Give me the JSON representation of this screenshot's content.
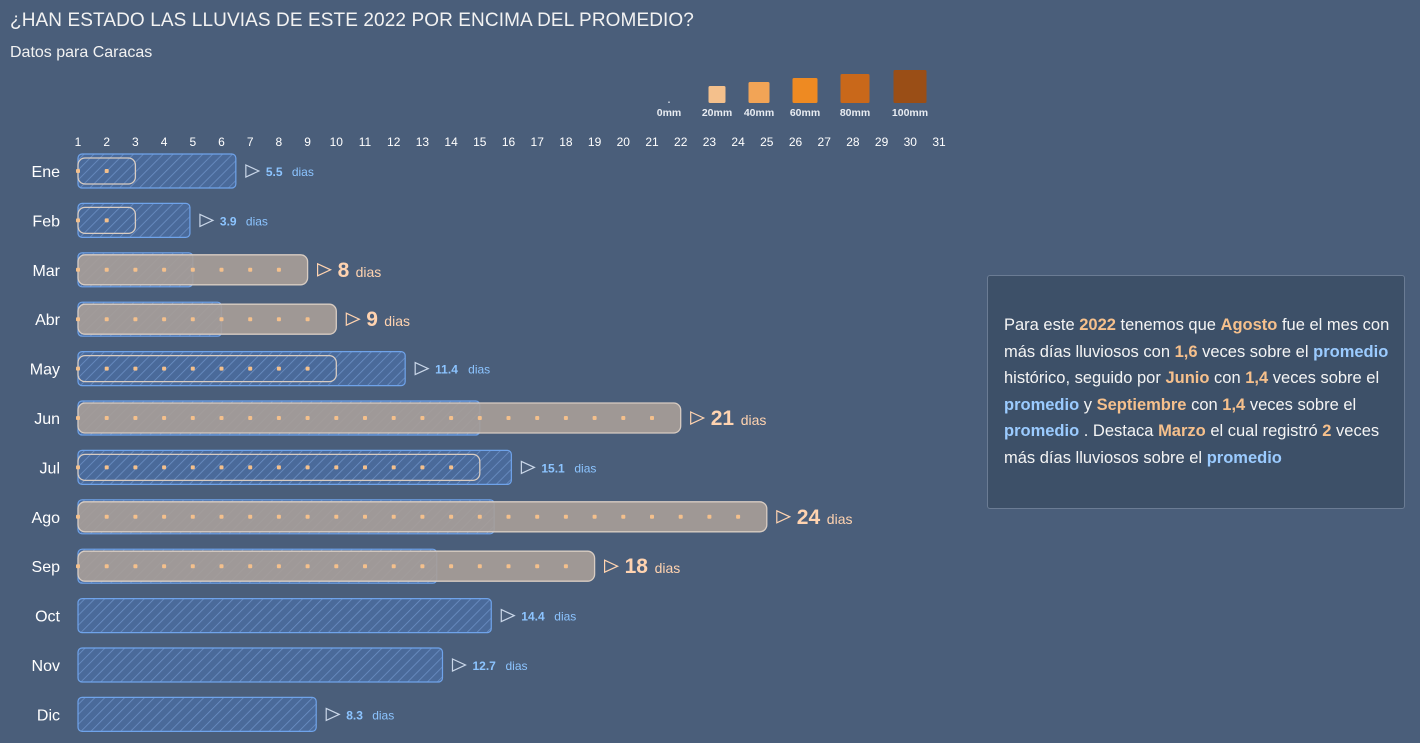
{
  "title": "¿HAN ESTADO LAS LLUVIAS DE ESTE 2022 POR ENCIMA DEL PROMEDIO?",
  "subtitle": "Datos para Caracas",
  "colors": {
    "background": "#4a5e7a",
    "avg_bar_fill": "#4a6a9a",
    "avg_bar_stroke": "#6fa3ea",
    "bar_2022_fill": "#a89e98",
    "bar_2022_stroke": "#d8ccc2",
    "avg_label": "#8cc4ff",
    "label_2022": "#ffd3b0",
    "square_20": "#f4c08c",
    "square_40": "#f2a456",
    "square_60": "#ee8a22",
    "square_80": "#c9681a",
    "square_100": "#9a4e16"
  },
  "callout": {
    "p1": "Para este",
    "v1": "2022",
    "p2": "tenemos que",
    "v2": "Agosto",
    "p3": "fue el mes con más días lluviosos con",
    "v3": "1,6",
    "p4": "veces sobre el",
    "v4": "promedio",
    "p5": "histórico, seguido por",
    "v5": "Junio",
    "p6": "con",
    "v6": "1,4",
    "p7": "veces sobre el",
    "v7": "promedio",
    "p8": "y",
    "v8": "Septiembre",
    "p9": "con",
    "v9": "1,4",
    "p10": "veces sobre el",
    "v10": "promedio",
    "p11": ". Destaca",
    "v11": "Marzo",
    "p12": "el cual registró",
    "v12": "2",
    "p13": "veces más días lluviosos sobre el",
    "v13": "promedio"
  },
  "chart_data": {
    "type": "bar",
    "x_ticks": [
      1,
      2,
      3,
      4,
      5,
      6,
      7,
      8,
      9,
      10,
      11,
      12,
      13,
      14,
      15,
      16,
      17,
      18,
      19,
      20,
      21,
      22,
      23,
      24,
      25,
      26,
      27,
      28,
      29,
      30,
      31
    ],
    "unit_label": "dias",
    "legend": {
      "placement": "top-right",
      "labels": [
        "0mm",
        "20mm",
        "40mm",
        "60mm",
        "80mm",
        "100mm"
      ],
      "values": [
        0,
        20,
        40,
        60,
        80,
        100
      ]
    },
    "months": [
      {
        "name": "Ene",
        "avg_days": 5.5,
        "avg_label": "5.5",
        "days_2022": 2,
        "label_2022": "",
        "rain_mm": [
          0,
          0,
          0,
          0,
          0,
          0,
          0,
          0,
          0,
          0,
          0,
          0,
          0,
          0,
          0,
          0,
          0,
          0,
          0,
          0,
          0,
          0,
          0,
          0,
          0,
          0,
          0,
          0,
          0,
          0,
          0
        ]
      },
      {
        "name": "Feb",
        "avg_days": 3.9,
        "avg_label": "3.9",
        "days_2022": 2,
        "label_2022": "",
        "rain_mm": [
          0,
          0,
          0,
          0,
          0,
          0,
          0,
          0,
          0,
          0,
          0,
          0,
          0,
          0,
          0,
          0,
          0,
          0,
          0,
          0,
          0,
          0,
          0,
          0,
          0,
          0,
          0,
          0,
          0,
          0,
          0
        ]
      },
      {
        "name": "Mar",
        "avg_days": 4,
        "avg_label": "",
        "days_2022": 8,
        "label_2022": "8",
        "rain_mm": [
          0,
          0,
          0,
          0,
          0,
          0,
          0,
          0,
          0,
          0,
          0,
          0,
          0,
          0,
          0,
          0,
          0,
          0,
          0,
          0,
          0,
          0,
          0,
          0,
          0,
          0,
          0,
          0,
          0,
          0,
          0
        ]
      },
      {
        "name": "Abr",
        "avg_days": 5,
        "avg_label": "",
        "days_2022": 9,
        "label_2022": "9",
        "rain_mm": [
          0,
          0,
          0,
          0,
          0,
          0,
          0,
          0,
          0,
          0,
          0,
          0,
          0,
          0,
          0,
          0,
          0,
          0,
          0,
          0,
          0,
          0,
          0,
          0,
          0,
          0,
          0,
          0,
          0,
          0,
          0
        ]
      },
      {
        "name": "May",
        "avg_days": 11.4,
        "avg_label": "11.4",
        "days_2022": 9,
        "label_2022": "",
        "rain_mm": [
          0,
          0,
          0,
          0,
          0,
          0,
          0,
          0,
          0,
          0,
          0,
          0,
          0,
          0,
          0,
          0,
          0,
          0,
          0,
          0,
          0,
          0,
          0,
          0,
          0,
          0,
          0,
          0,
          0,
          0,
          0
        ]
      },
      {
        "name": "Jun",
        "avg_days": 14,
        "avg_label": "",
        "days_2022": 21,
        "label_2022": "21",
        "rain_mm": [
          0,
          0,
          0,
          0,
          0,
          0,
          0,
          0,
          0,
          0,
          0,
          0,
          0,
          0,
          0,
          0,
          0,
          0,
          0,
          0,
          0,
          0,
          0,
          0,
          0,
          0,
          0,
          0,
          0,
          0,
          0
        ]
      },
      {
        "name": "Jul",
        "avg_days": 15.1,
        "avg_label": "15.1",
        "days_2022": 14,
        "label_2022": "",
        "rain_mm": [
          0,
          0,
          0,
          0,
          0,
          0,
          0,
          0,
          0,
          0,
          0,
          0,
          0,
          0,
          0,
          0,
          0,
          0,
          0,
          0,
          0,
          0,
          0,
          0,
          0,
          0,
          0,
          0,
          0,
          0,
          0
        ]
      },
      {
        "name": "Ago",
        "avg_days": 14.5,
        "avg_label": "",
        "days_2022": 24,
        "label_2022": "24",
        "rain_mm": [
          0,
          0,
          0,
          0,
          0,
          0,
          0,
          0,
          0,
          0,
          0,
          0,
          0,
          0,
          0,
          0,
          0,
          0,
          0,
          0,
          0,
          0,
          0,
          0,
          0,
          0,
          0,
          0,
          0,
          0,
          0
        ]
      },
      {
        "name": "Sep",
        "avg_days": 12.5,
        "avg_label": "",
        "days_2022": 18,
        "label_2022": "18",
        "rain_mm": [
          0,
          0,
          0,
          0,
          0,
          0,
          0,
          0,
          0,
          0,
          0,
          0,
          0,
          0,
          0,
          0,
          0,
          0,
          0,
          0,
          0,
          0,
          0,
          0,
          0,
          0,
          0,
          0,
          0,
          0,
          0
        ]
      },
      {
        "name": "Oct",
        "avg_days": 14.4,
        "avg_label": "14.4",
        "days_2022": 0,
        "label_2022": "",
        "rain_mm": [
          0,
          0,
          0,
          0,
          0,
          0,
          0,
          0,
          0,
          0,
          0,
          0,
          0,
          0,
          0,
          0,
          0,
          0,
          0,
          0,
          0,
          0,
          0,
          0,
          0,
          0,
          0,
          0,
          0,
          0,
          0
        ]
      },
      {
        "name": "Nov",
        "avg_days": 12.7,
        "avg_label": "12.7",
        "days_2022": 0,
        "label_2022": "",
        "rain_mm": [
          0,
          0,
          0,
          0,
          0,
          0,
          0,
          0,
          0,
          0,
          0,
          0,
          0,
          0,
          0,
          0,
          0,
          0,
          0,
          0,
          0,
          0,
          0,
          0,
          0,
          0,
          0,
          0,
          0,
          0,
          0
        ]
      },
      {
        "name": "Dic",
        "avg_days": 8.3,
        "avg_label": "8.3",
        "days_2022": 0,
        "label_2022": "",
        "rain_mm": [
          0,
          0,
          0,
          0,
          0,
          0,
          0,
          0,
          0,
          0,
          0,
          0,
          0,
          0,
          0,
          0,
          0,
          0,
          0,
          0,
          0,
          0,
          0,
          0,
          0,
          0,
          0,
          0,
          0,
          0,
          0
        ]
      }
    ]
  }
}
